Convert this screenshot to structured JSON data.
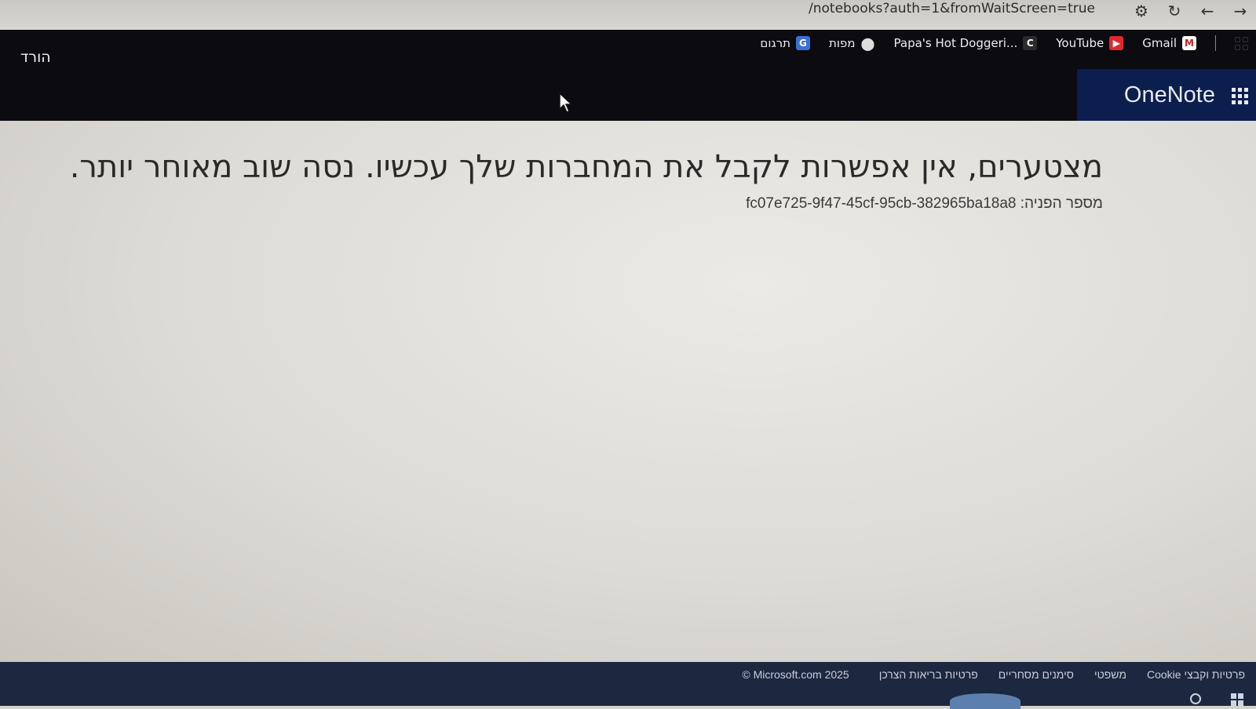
{
  "browser": {
    "address_text": "/notebooks?auth=1&fromWaitScreen=true",
    "bookmarks": [
      {
        "label": "Gmail",
        "icon": "gmail-icon",
        "color": "#c5221f"
      },
      {
        "label": "YouTube",
        "icon": "youtube-icon",
        "color": "#e0282c"
      },
      {
        "label": "Papa's Hot Doggeri...",
        "icon": "papas-game-icon",
        "color": "#2b2b2b"
      },
      {
        "label": "מפות",
        "icon": "maps-pin-icon",
        "color": "#333333"
      },
      {
        "label": "תרגום",
        "icon": "translate-icon",
        "color": "#3b6fd4"
      }
    ]
  },
  "header": {
    "download_link": "הורד",
    "app_title": "OneNote",
    "accent_color": "#0c1e4e"
  },
  "main": {
    "error_message": "מצטערים, אין אפשרות לקבל את המחברות שלך עכשיו. נסה שוב מאוחר יותר.",
    "request_id": "מספר הפניה: fc07e725-9f47-45cf-95cb-382965ba18a8"
  },
  "footer": {
    "links": [
      "פרטיות וקבצי Cookie",
      "משפטי",
      "סימנים מסחריים",
      "פרטיות בריאות הצרכן"
    ],
    "copyright": "Microsoft.com 2025 ©"
  }
}
